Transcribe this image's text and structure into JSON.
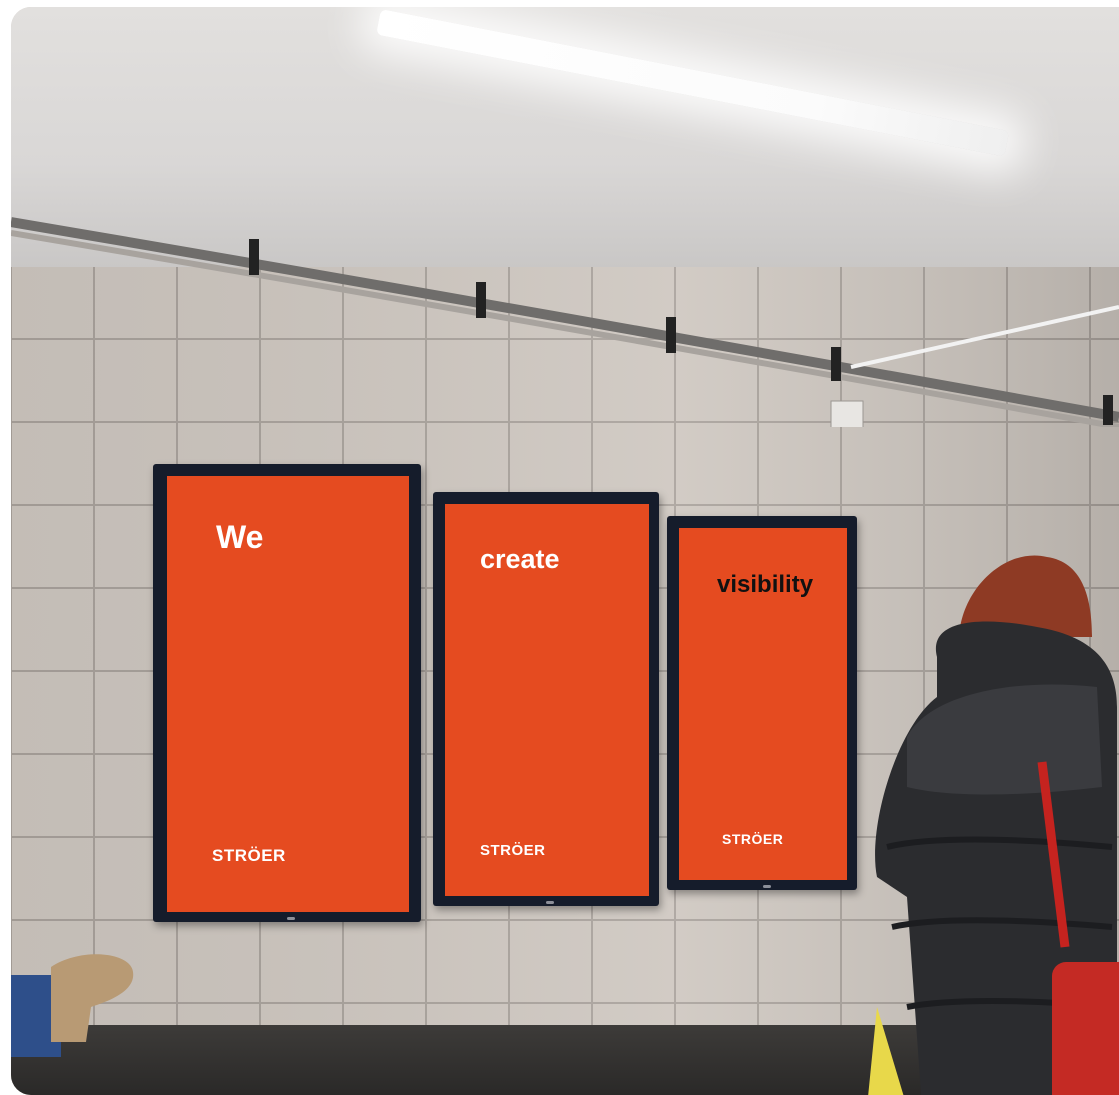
{
  "screens": [
    {
      "headline": "We",
      "headline_color": "#ffffff",
      "brand": "STRÖER"
    },
    {
      "headline": "create",
      "headline_color": "#ffffff",
      "brand": "STRÖER"
    },
    {
      "headline": "visibility",
      "headline_color": "#111111",
      "brand": "STRÖER"
    }
  ],
  "colors": {
    "poster_orange": "#e54b20",
    "screen_frame": "#151c2b",
    "tile": "#cfc8c1"
  }
}
